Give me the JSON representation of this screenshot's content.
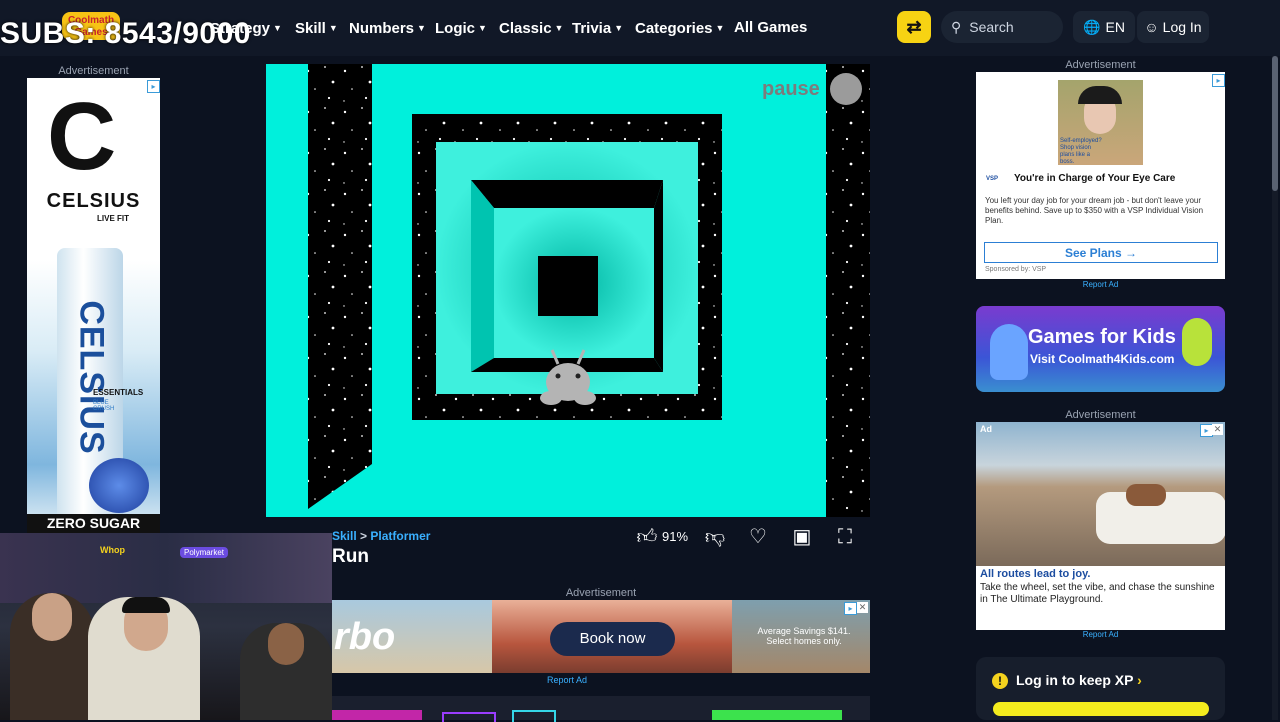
{
  "overlay": {
    "subs_text": "SUBS: 8543/9000"
  },
  "header": {
    "logo_text": "Coolmath Games",
    "nav": [
      {
        "label": "Strategy"
      },
      {
        "label": "Skill"
      },
      {
        "label": "Numbers"
      },
      {
        "label": "Logic"
      },
      {
        "label": "Classic"
      },
      {
        "label": "Trivia"
      },
      {
        "label": "Categories"
      }
    ],
    "all_games": "All Games",
    "search_placeholder": "Search",
    "lang": "EN",
    "login": "Log In"
  },
  "left_ad": {
    "label": "Advertisement",
    "brand": "CELSIUS",
    "tagline": "LIVE FIT",
    "can_text": "CELSIUS",
    "essentials": "ESSENTIALS",
    "flavor": "BLUE CRUSH",
    "footer": "ZERO SUGAR"
  },
  "game": {
    "pause_label": "pause",
    "breadcrumb_category": "Skill",
    "breadcrumb_sep": ">",
    "breadcrumb_sub": "Platformer",
    "title": "Run",
    "rating": "91%"
  },
  "bottom_ad": {
    "label": "Advertisement",
    "brand_fragment": "rbo",
    "cta": "Book now",
    "savings": "Average Savings $141.",
    "savings_sub": "Select homes only.",
    "report": "Report Ad"
  },
  "right_ad1": {
    "label": "Advertisement",
    "image_text": "Self-employed? Shop vision plans like a boss.",
    "logo": "VSP",
    "headline": "You're in Charge of Your Eye Care",
    "body": "You left your day job for your dream job - but don't leave your benefits behind. Save up to $350 with a VSP Individual Vision Plan.",
    "cta": "See Plans",
    "sponsor": "Sponsored by: VSP",
    "report": "Report Ad"
  },
  "kids_banner": {
    "title": "Games for Kids",
    "subtitle": "Visit Coolmath4Kids.com"
  },
  "right_ad2": {
    "label": "Advertisement",
    "ad_tag": "Ad",
    "headline": "All routes lead to joy.",
    "body": "Take the wheel, set the vibe, and chase the sunshine in The Ultimate Playground.",
    "report": "Report Ad"
  },
  "xp_panel": {
    "text": "Log in to keep XP"
  },
  "webcam": {
    "sponsor1": "Whop",
    "sponsor2": "Polymarket"
  }
}
